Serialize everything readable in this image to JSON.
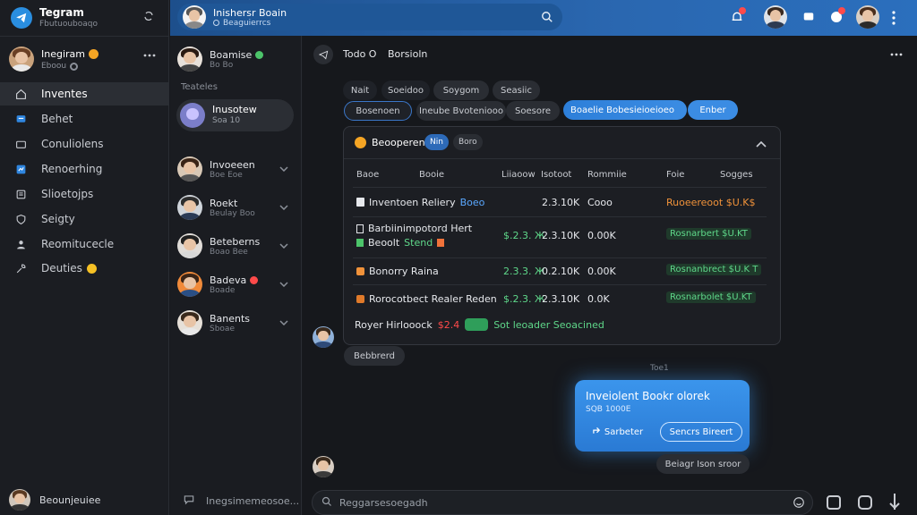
{
  "app": {
    "title": "Tegram",
    "subtitle": "Fbutuouboaqo"
  },
  "profile": {
    "name": "Inegiram",
    "status": "Eboou"
  },
  "nav": [
    {
      "label": "Inventes",
      "icon": "home-icon",
      "active": true
    },
    {
      "label": "Behet",
      "icon": "chat-icon"
    },
    {
      "label": "Conuliolens",
      "icon": "folder-icon"
    },
    {
      "label": "Renoerhing",
      "icon": "blue-app-icon"
    },
    {
      "label": "Slioetojps",
      "icon": "list-icon"
    },
    {
      "label": "Seigty",
      "icon": "shield-icon"
    },
    {
      "label": "Reomitucecle",
      "icon": "user-icon"
    },
    {
      "label": "Deuties",
      "icon": "wrench-icon"
    }
  ],
  "left_footer": {
    "label": "Beounjeuiee"
  },
  "header": {
    "search_title": "Inishersr Boain",
    "search_sub": "Beaguierrcs"
  },
  "chat_list": {
    "top_item": {
      "name": "Boamise",
      "sub": "Bo Bo"
    },
    "section_label": "Teateles",
    "selected": {
      "name": "Inusotew",
      "sub": "Soa 10"
    },
    "items": [
      {
        "name": "Invoeeen",
        "sub": "Boe Eoe"
      },
      {
        "name": "Roekt",
        "sub": "Beulay Boo"
      },
      {
        "name": "Beteberns",
        "sub": "Boao Bee"
      },
      {
        "name": "Badeva",
        "sub": "Boade"
      },
      {
        "name": "Banents",
        "sub": "Sboae"
      }
    ],
    "footer_text": "Inegsimemeosoe..."
  },
  "conversation": {
    "title_left": "Todo O",
    "title_right": "Borsioln",
    "filters_row1": [
      "Nait",
      "Soeidoo",
      "Soygom",
      "Seasiic"
    ],
    "filters_row2": [
      "Bosenoen",
      "Ineube Bvoteniooo",
      "Soesore",
      "Boaelie Bobesieioeioeo",
      "Enber"
    ],
    "card": {
      "title": "Beooperen",
      "tag": "Nin",
      "tag2": "Boro",
      "headers": [
        "Baoe",
        "Booie",
        "Liiaoow",
        "Isotoot",
        "Rommiie",
        "Foie",
        "Sogges"
      ],
      "rows": [
        {
          "name": "Inventoen Reliery",
          "name_extra": "Boeo",
          "qty": "",
          "price": "2.3.10K",
          "delta": "Cooo",
          "status": "Ruoeereoot $U.K$"
        },
        {
          "name": "Barbiinimpotord Hert",
          "name2": "Beoolt",
          "name2_extra": "Stend",
          "qty": "$.2.3. Ж",
          "price": "2.3.10K",
          "delta": "0.00K",
          "status": "Rosnarbert $U.KT"
        },
        {
          "name": "Bonorry Raina",
          "qty": "2.3.3. Ж",
          "price": "0.2.10K",
          "delta": "0.00K",
          "status": "Rosnanbrect $U.K T"
        },
        {
          "name": "Rorocotbect Realer Reden",
          "qty": "$.2.3. Ж",
          "price": "2.3.10K",
          "delta": "0.0K",
          "status": "Rosnarbolet $U.KT"
        }
      ],
      "footer_text": "Royer Hirlooock",
      "footer_red": "$2.4",
      "footer_status": "Sot leoader Seoacined"
    },
    "sender_bubble_label": "Bebbrerd",
    "time_label": "Toe1",
    "bubble": {
      "title": "Inveiolent Bookr olorek",
      "sub": "SQB 1000E",
      "btn1": "Sarbeter",
      "btn2": "Sencrs Bireert"
    },
    "reply_chip": "Beiagr Ison sroor",
    "input_placeholder": "Reggarsesoegadh"
  }
}
